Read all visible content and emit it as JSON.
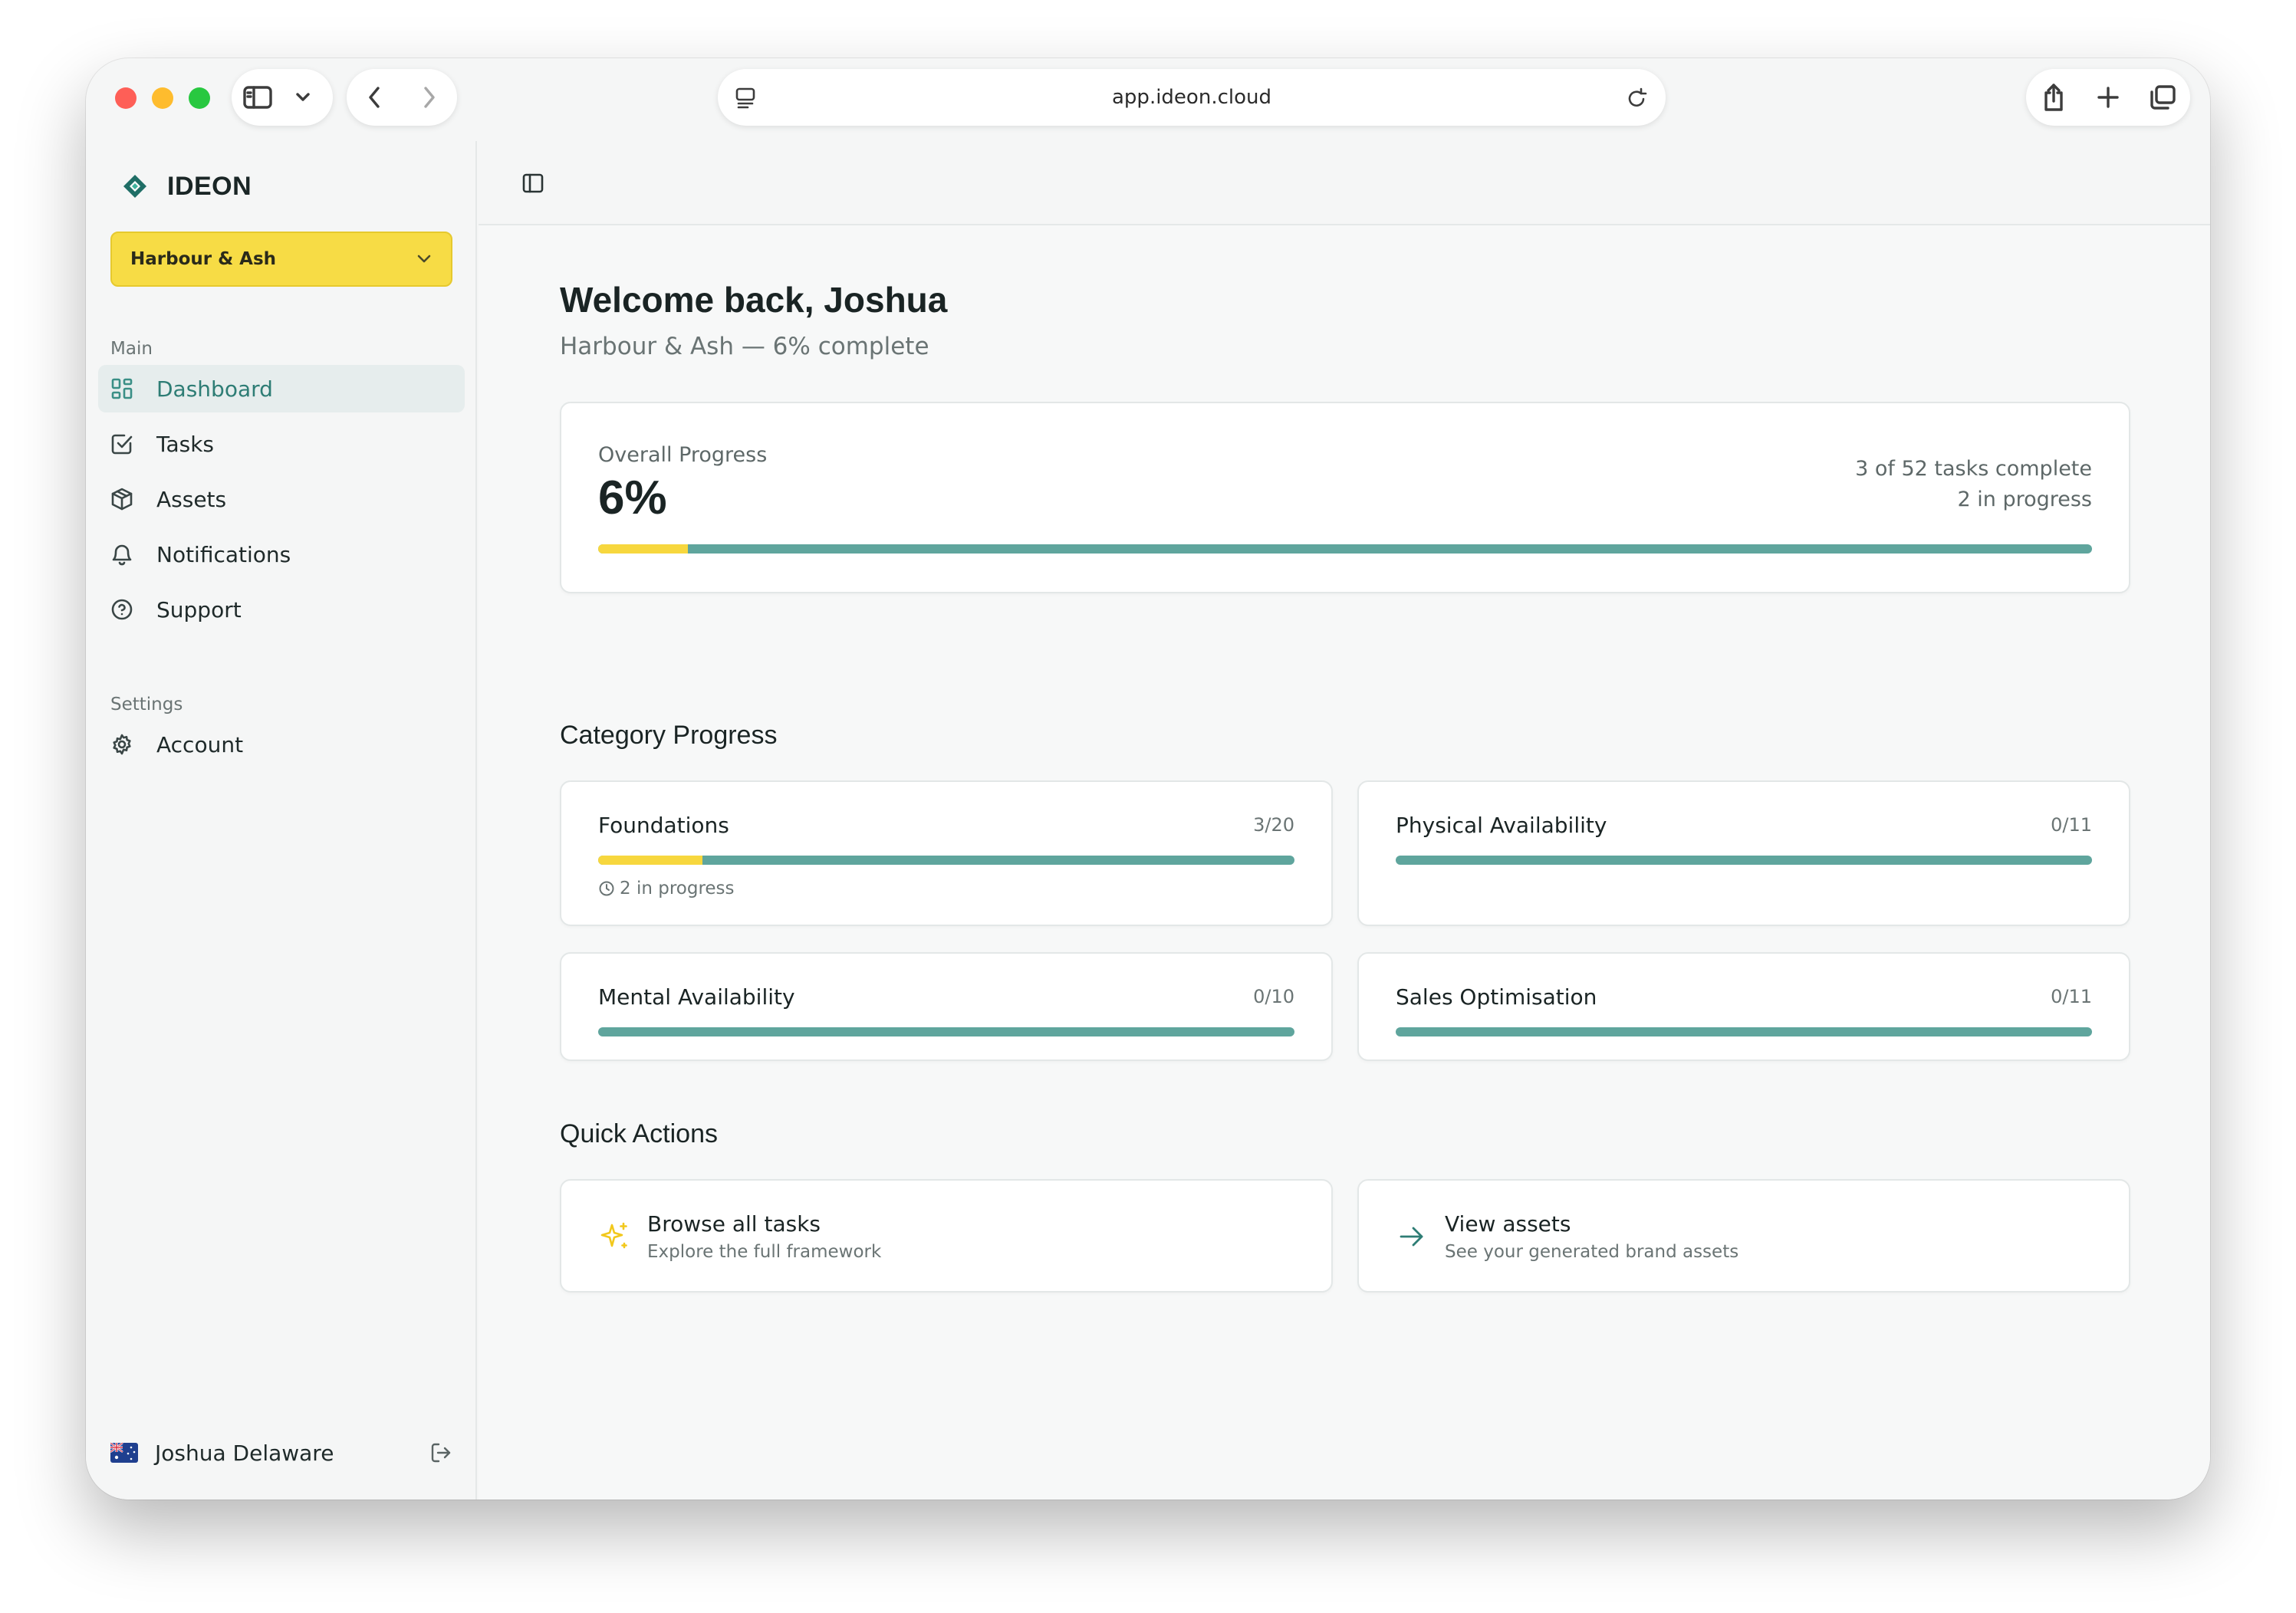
{
  "browser": {
    "url": "app.ideon.cloud"
  },
  "sidebar": {
    "brand": "IDEON",
    "org_selector": "Harbour & Ash",
    "main_label": "Main",
    "items": [
      {
        "label": "Dashboard",
        "icon": "dashboard-icon",
        "active": true
      },
      {
        "label": "Tasks",
        "icon": "checkbox-icon"
      },
      {
        "label": "Assets",
        "icon": "cube-icon"
      },
      {
        "label": "Notifications",
        "icon": "bell-icon"
      },
      {
        "label": "Support",
        "icon": "help-icon"
      }
    ],
    "settings_label": "Settings",
    "settings_items": [
      {
        "label": "Account",
        "icon": "gear-icon"
      }
    ],
    "user": {
      "name": "Joshua Delaware",
      "flag": "australia-flag-icon"
    }
  },
  "main": {
    "title": "Welcome back, Joshua",
    "subtitle": "Harbour & Ash — 6% complete",
    "overall": {
      "label": "Overall Progress",
      "percent": "6%",
      "tasks_complete": "3 of 52 tasks complete",
      "in_progress": "2 in progress",
      "fraction": 0.06
    },
    "category_title": "Category Progress",
    "categories": [
      {
        "name": "Foundations",
        "count": "3/20",
        "fraction": 0.15,
        "sub": "2 in progress"
      },
      {
        "name": "Physical Availability",
        "count": "0/11",
        "fraction": 0
      },
      {
        "name": "Mental Availability",
        "count": "0/10",
        "fraction": 0
      },
      {
        "name": "Sales Optimisation",
        "count": "0/11",
        "fraction": 0
      }
    ],
    "quick_title": "Quick Actions",
    "quick_actions": [
      {
        "title": "Browse all tasks",
        "desc": "Explore the full framework",
        "icon": "sparkle-icon"
      },
      {
        "title": "View assets",
        "desc": "See your generated brand assets",
        "icon": "arrow-right-icon"
      }
    ]
  },
  "colors": {
    "accent_yellow": "#f7d73e",
    "accent_teal": "#5fa59d",
    "active_text": "#2e7d75"
  }
}
